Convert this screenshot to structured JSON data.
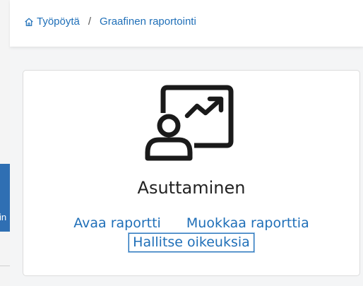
{
  "breadcrumb": {
    "home_label": "Työpöytä",
    "separator": "/",
    "current_label": "Graafinen raportointi"
  },
  "sidebar": {
    "partial_label": "in"
  },
  "report_card": {
    "title": "Asuttaminen",
    "icon": "presentation-chart-icon",
    "links": {
      "open": "Avaa raportti",
      "edit": "Muokkaa raporttia",
      "permissions": "Hallitse oikeuksia"
    }
  },
  "colors": {
    "link": "#1f6fb8",
    "sidebar_accent": "#2f6fb3"
  }
}
